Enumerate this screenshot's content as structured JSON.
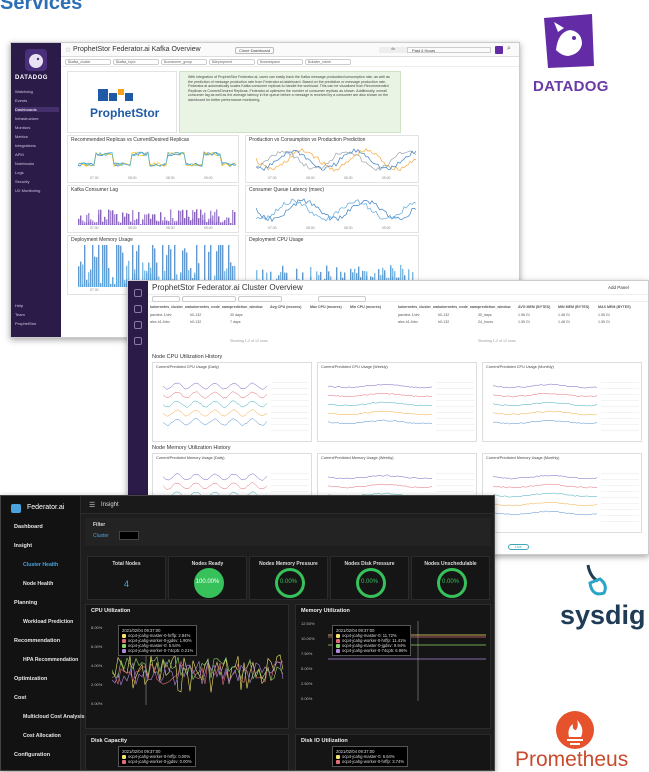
{
  "heading": "Services",
  "datadog": {
    "brand": "DATADOG",
    "dashboard_title": "ProphetStor Federator.ai Kafka Overview",
    "clone_label": "Clone Dashboard",
    "time_label": "Past 4 Hours",
    "time_prefix": "4h",
    "nav": [
      "Watchdog",
      "Events",
      "Dashboards",
      "Infrastructure",
      "Monitors",
      "Metrics",
      "Integrations",
      "APM",
      "Notebooks",
      "Logs",
      "Security",
      "UX Monitoring"
    ],
    "nav_bottom": [
      "Help",
      "Team",
      "ProphetStor"
    ],
    "filters": [
      "$kafka_cluster",
      "$kafka_topic",
      "$consumer_group",
      "$deployment",
      "$namespace",
      "$cluster_name"
    ],
    "logo_text": "ProphetStor",
    "note": "With integration of ProphetStor Federator.ai, users can easily track the Kafka message production/consumption rate, as well as the prediction of message production rate from Federator.ai dashboard. Based on the prediction or message production rate, Federator.ai automatically scales Kafka consumer replicas to handle the workload. This can be visualized from Recommended Replicas vs Current/Desired Replicas. Federator.ai optimizes the number of consumer replicas as shown. Additionally, overall consumer lag as well as the average latency in the queue before a message is received by a consumer are also shown on the dashboard for better performance monitoring.",
    "panels": [
      "Recommended Replicas vs Current/Desired Replicas",
      "Production vs Consumption vs Production Prediction",
      "Kafka Consumer Lag",
      "Consumer Queue Latency (msec)",
      "Deployment Memory Usage",
      "Deployment CPU Usage"
    ],
    "xticks": [
      "07:30",
      "08:00",
      "08:30",
      "09:00"
    ]
  },
  "cluster": {
    "title": "ProphetStor Federator.ai Cluster Overview",
    "add_panel": "Add Panel",
    "table_headers": [
      "kubernetes_cluster_name",
      "kubernetes_node_name",
      "prediction_window",
      "Avg CPU (mcores)",
      "Max CPU (mcores)",
      "Min CPU (mcores)"
    ],
    "table_rows": [
      [
        "jasmine-1/drv",
        "h0-132",
        "30 days",
        "",
        "",
        ""
      ],
      [
        "alex-h1-f/drv",
        "h0-132",
        "7 days",
        "",
        "",
        ""
      ]
    ],
    "table_headers2": [
      "kubernetes_cluster_name",
      "kubernetes_node_name",
      "prediction_window",
      "AVG MEM (BYTES)",
      "MIN MEM (BYTES)",
      "MAX MEM (BYTES)"
    ],
    "table_rows2": [
      [
        "jasmine-1/drv",
        "h0-132",
        "30_days",
        "1.56 Gi",
        "1.48 Gi",
        "1.55 Gi"
      ],
      [
        "alex-h1-f/drv",
        "h0-132",
        "24_hours",
        "1.55 Gi",
        "1.48 Gi",
        "1.55 Gi"
      ]
    ],
    "showing": "Showing 1-2 of 12 rows",
    "section1": "Node CPU Utilization History",
    "section2": "Node Memory Utilization History",
    "cpu_panels": [
      "Current/Predicted CPU Usage (Daily)",
      "Current/Predicted CPU Usage (Weekly)",
      "Current/Predicted CPU Usage (Monthly)"
    ],
    "mem_panels": [
      "Current/Predicted Memory Usage (Daily)",
      "Current/Predicted Memory Usage (Weekly)",
      "Current/Predicted Memory Usage (Monthly)"
    ],
    "footer_time": "Jan 18, 9:00 am - Feb 1, 9:00 am",
    "footer_zoom": "Last 14 days (1 hr intervals)",
    "footer_live": "Live"
  },
  "federator": {
    "brand": "Federator.ai",
    "breadcrumb": "Insight",
    "filter_label": "Filter",
    "cluster_label": "Cluster",
    "nav": [
      {
        "label": "Dashboard",
        "sub": false
      },
      {
        "label": "Insight",
        "sub": false
      },
      {
        "label": "Cluster Health",
        "sub": true,
        "sel": true
      },
      {
        "label": "Node Health",
        "sub": true
      },
      {
        "label": "Planning",
        "sub": false
      },
      {
        "label": "Workload Prediction",
        "sub": true
      },
      {
        "label": "Recommendation",
        "sub": false
      },
      {
        "label": "HPA Recommendation",
        "sub": true
      },
      {
        "label": "Optimization",
        "sub": false
      },
      {
        "label": "Cost",
        "sub": false
      },
      {
        "label": "Multicloud Cost Analysis",
        "sub": true
      },
      {
        "label": "Cost Allocation",
        "sub": true
      },
      {
        "label": "Configuration",
        "sub": false
      },
      {
        "label": "Events",
        "sub": false
      }
    ],
    "stats": [
      {
        "title": "Total Nodes",
        "value": "4"
      },
      {
        "title": "Nodes Ready",
        "value": "100.00%"
      },
      {
        "title": "Nodes Memory Pressure",
        "value": "0.00%"
      },
      {
        "title": "Nodes Disk Pressure",
        "value": "0.00%"
      },
      {
        "title": "Nodes Unschedulable",
        "value": "0.00%"
      }
    ],
    "cpu_title": "CPU Utilization",
    "mem_title": "Memory Utilization",
    "disk_title": "Disk Capacity",
    "diskio_title": "Disk IO Utilization",
    "cpu_yticks": [
      "8.00%",
      "6.00%",
      "4.00%",
      "2.00%",
      "0.00%"
    ],
    "mem_yticks": [
      "12.50%",
      "10.00%",
      "7.50%",
      "5.00%",
      "2.50%",
      "0.00%"
    ],
    "cpu_tip": {
      "time": "2021/02/04 09:37:00",
      "rows": [
        "ocp4-jcahg-master-0-hrffp: 2.84%",
        "ocp4-jcahg-worker-0-jgdsv: 1.90%",
        "ocp4-jcahg-master-0: 5.54%",
        "ocp4-jcahg-worker-0-74cp5: 0.21%"
      ]
    },
    "mem_tip": {
      "time": "2021/02/04 09:37:00",
      "rows": [
        "ocp4-jcahg-master-0: 11.72%",
        "ocp4-jcahg-worker-0-hrffp: 11.41%",
        "ocp4-jcahg-master-0-jgdsv: 9.94%",
        "ocp4-jcahg-worker-0-74cp5: 6.96%"
      ]
    },
    "disk_tip": {
      "time": "2021/02/04 09:37:00",
      "rows": [
        "ocp4-jcahg-worker-0-hrffp: 0.00%",
        "ocp4-jcahg-worker-0-jgdsv: 0.00%"
      ]
    },
    "diskio_tip": {
      "time": "2021/02/04 09:37:00",
      "rows": [
        "ocp4-jcahg-master-0: 6.64%",
        "ocp4-jcahg-worker-0-hrffp: 3.74%"
      ]
    },
    "xticks": [
      "09:10\n02/04",
      "09:20\n02/04",
      "09:30\n02/04",
      "09:40\n02/04",
      "09:50\n02/04"
    ],
    "legend": [
      "ocp4-jcahg-master-0",
      "ocp4-jcahg-worker-0-hrffp",
      "ocp4-jcahg-worker-0-jgdsv",
      "ocp4-jcahg-worker-0-74cp5"
    ]
  },
  "logos": {
    "datadog": "DATADOG",
    "sysdig": "sysdig",
    "prometheus": "Prometheus"
  },
  "colors": {
    "datadog_purple": "#632ca6",
    "ok_green": "#37c15b",
    "sysdig_navy": "#1f3b56",
    "prometheus_orange": "#e6522c"
  }
}
